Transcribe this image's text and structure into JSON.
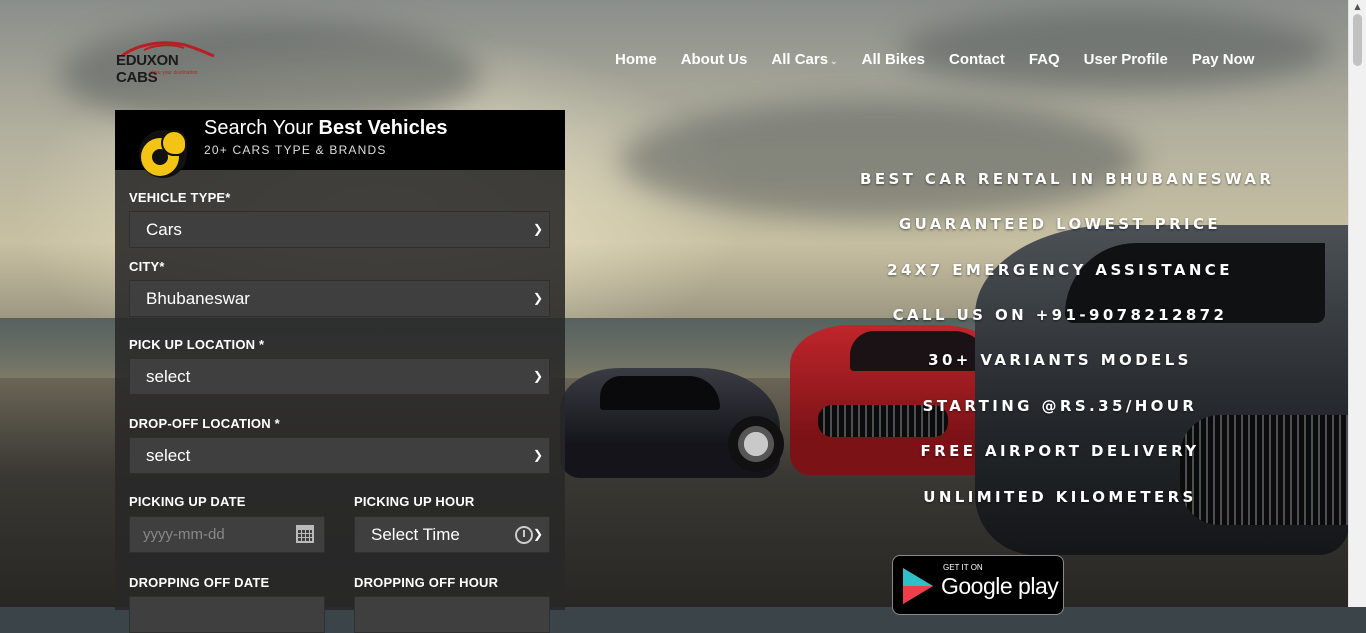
{
  "brand": {
    "name": "EDUXON CABS",
    "tagline": "drive your destination"
  },
  "nav": {
    "items": [
      "Home",
      "About Us",
      "All Cars",
      "All Bikes",
      "Contact",
      "FAQ",
      "User Profile",
      "Pay Now"
    ]
  },
  "search_panel": {
    "title_prefix": "Search Your ",
    "title_bold": "Best Vehicles",
    "subtitle": "20+ CARS TYPE & BRANDS",
    "vehicle_type": {
      "label": "VEHICLE TYPE*",
      "value": "Cars"
    },
    "city": {
      "label": "CITY*",
      "value": "Bhubaneswar"
    },
    "pickup_location": {
      "label": "PICK UP LOCATION *",
      "value": "select"
    },
    "dropoff_location": {
      "label": "DROP-OFF LOCATION *",
      "value": "select"
    },
    "pickup_date": {
      "label": "PICKING UP DATE",
      "placeholder": "yyyy-mm-dd"
    },
    "pickup_hour": {
      "label": "PICKING UP HOUR",
      "value": "Select Time"
    },
    "dropoff_date": {
      "label": "DROPPING OFF DATE"
    },
    "dropoff_hour": {
      "label": "DROPPING OFF HOUR"
    }
  },
  "features": [
    "BEST CAR RENTAL IN BHUBANESWAR",
    "GUARANTEED LOWEST PRICE",
    "24X7 EMERGENCY ASSISTANCE",
    "CALL US ON +91-9078212872",
    "30+ VARIANTS MODELS",
    "STARTING @RS.35/HOUR",
    "FREE AIRPORT DELIVERY",
    "UNLIMITED KILOMETERS"
  ],
  "google_play": {
    "small": "GET IT ON",
    "large": "Google play"
  },
  "colors": {
    "accent_yellow": "#f4c414",
    "panel_bg": "#282828",
    "logo_red": "#b52025"
  }
}
